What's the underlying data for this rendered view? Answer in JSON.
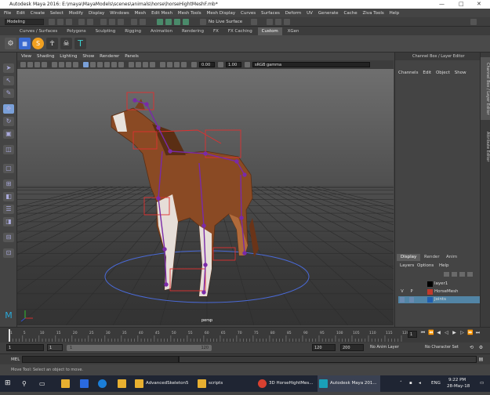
{
  "window": {
    "title": "Autodesk Maya 2016: E:\\maya\\MayaModels\\scenes\\animals\\horse\\horseHightMeshF.mb*",
    "minimize": "—",
    "maximize": "□",
    "close": "✕"
  },
  "menubar": [
    "File",
    "Edit",
    "Create",
    "Select",
    "Modify",
    "Display",
    "Windows",
    "Mesh",
    "Edit Mesh",
    "Mesh Tools",
    "Mesh Display",
    "Curves",
    "Surfaces",
    "Deform",
    "UV",
    "Generate",
    "Cache",
    "Ziva Tools",
    "Help"
  ],
  "statusline": {
    "menuset": "Modeling",
    "live_surface": "No Live Surface"
  },
  "shelf_tabs": [
    "Curves / Surfaces",
    "Polygons",
    "Sculpting",
    "Rigging",
    "Animation",
    "Rendering",
    "FX",
    "FX Caching",
    "Custom",
    "XGen"
  ],
  "shelf_active": "Custom",
  "viewport": {
    "menu": [
      "View",
      "Shading",
      "Lighting",
      "Show",
      "Renderer",
      "Panels"
    ],
    "field_a": "0.00",
    "field_b": "1.00",
    "color_space": "sRGB gamma",
    "camera_label": "persp"
  },
  "channel_box": {
    "header": "Channel Box / Layer Editor",
    "menu": [
      "Channels",
      "Edit",
      "Object",
      "Show"
    ],
    "side_tabs": [
      "Channel Box / Layer Editor",
      "Attribute Editor"
    ]
  },
  "layers": {
    "tabs": [
      "Display",
      "Render",
      "Anim"
    ],
    "active_tab": "Display",
    "menu": [
      "Layers",
      "Options",
      "Help"
    ],
    "rows": [
      {
        "vis": "",
        "pl": "",
        "name": "layer1",
        "color": "#000000",
        "selected": false
      },
      {
        "vis": "V",
        "pl": "P",
        "name": "HorseMesh",
        "color": "#c0392b",
        "selected": false
      },
      {
        "vis": "",
        "pl": "",
        "name": "Joints",
        "color": "#1f5fb0",
        "selected": true
      }
    ]
  },
  "timeslider": {
    "ticks": [
      "1",
      "5",
      "10",
      "15",
      "20",
      "25",
      "30",
      "35",
      "40",
      "45",
      "50",
      "55",
      "60",
      "65",
      "70",
      "75",
      "80",
      "85",
      "90",
      "95",
      "100",
      "105",
      "110",
      "115",
      "120"
    ],
    "current_frame": "1"
  },
  "range": {
    "start": "1",
    "inner_start": "1",
    "inner_end": "120",
    "end": "120",
    "max": "200",
    "anim_layer": "No Anim Layer",
    "char_set": "No Character Set"
  },
  "cmdline": {
    "label": "MEL"
  },
  "helpline": {
    "text": "Move Tool: Select an object to move."
  },
  "taskbar": {
    "apps": [
      {
        "label": "AdvancedSkeleton5",
        "active": false
      },
      {
        "label": "scripts",
        "active": false
      },
      {
        "label": "3D HorseHightMes...",
        "active": false
      },
      {
        "label": "Autodesk Maya 201...",
        "active": true
      }
    ],
    "lang": "ENG",
    "time": "9:22 PM",
    "date": "28-May-18"
  }
}
